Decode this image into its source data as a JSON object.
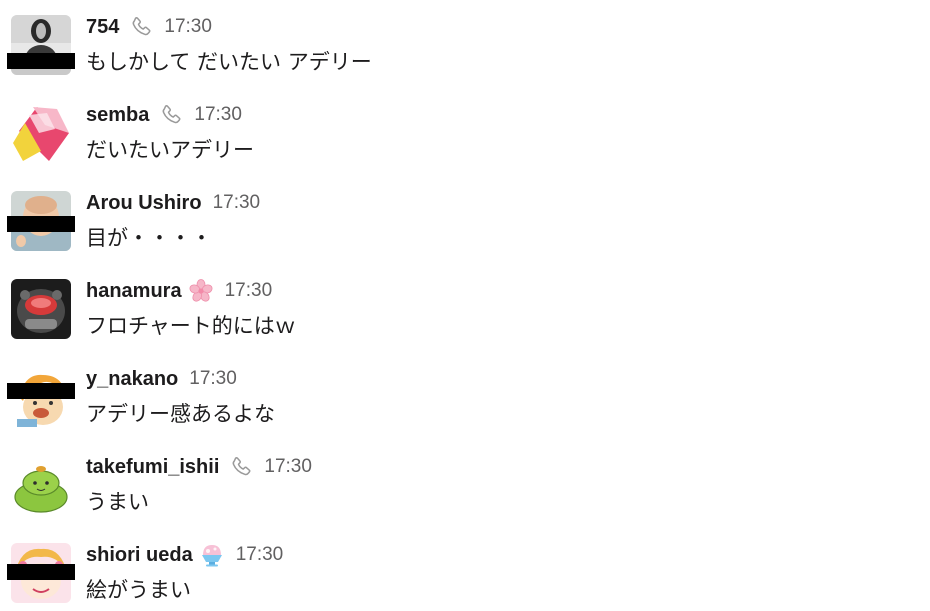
{
  "messages": [
    {
      "name": "754",
      "status_icon": "phone-icon",
      "time": "17:30",
      "text": "もしかして だいたい アデリー"
    },
    {
      "name": "semba",
      "status_icon": "phone-icon",
      "time": "17:30",
      "text": "だいたいアデリー"
    },
    {
      "name": "Arou Ushiro",
      "status_icon": "",
      "time": "17:30",
      "text": "目が・・・・"
    },
    {
      "name": "hanamura",
      "status_icon": "cherry-blossom-icon",
      "time": "17:30",
      "text": "フロチャート的にはｗ"
    },
    {
      "name": "y_nakano",
      "status_icon": "",
      "time": "17:30",
      "text": "アデリー感あるよな"
    },
    {
      "name": "takefumi_ishii",
      "status_icon": "phone-icon",
      "time": "17:30",
      "text": "うまい"
    },
    {
      "name": "shiori ueda",
      "status_icon": "shaved-ice-icon",
      "time": "17:30",
      "text": "絵がうまい"
    }
  ],
  "colors": {
    "text": "#1d1c1d",
    "timestamp": "#616061",
    "icon_gray": "#9a9a9a",
    "censor_bar": "#000000"
  }
}
